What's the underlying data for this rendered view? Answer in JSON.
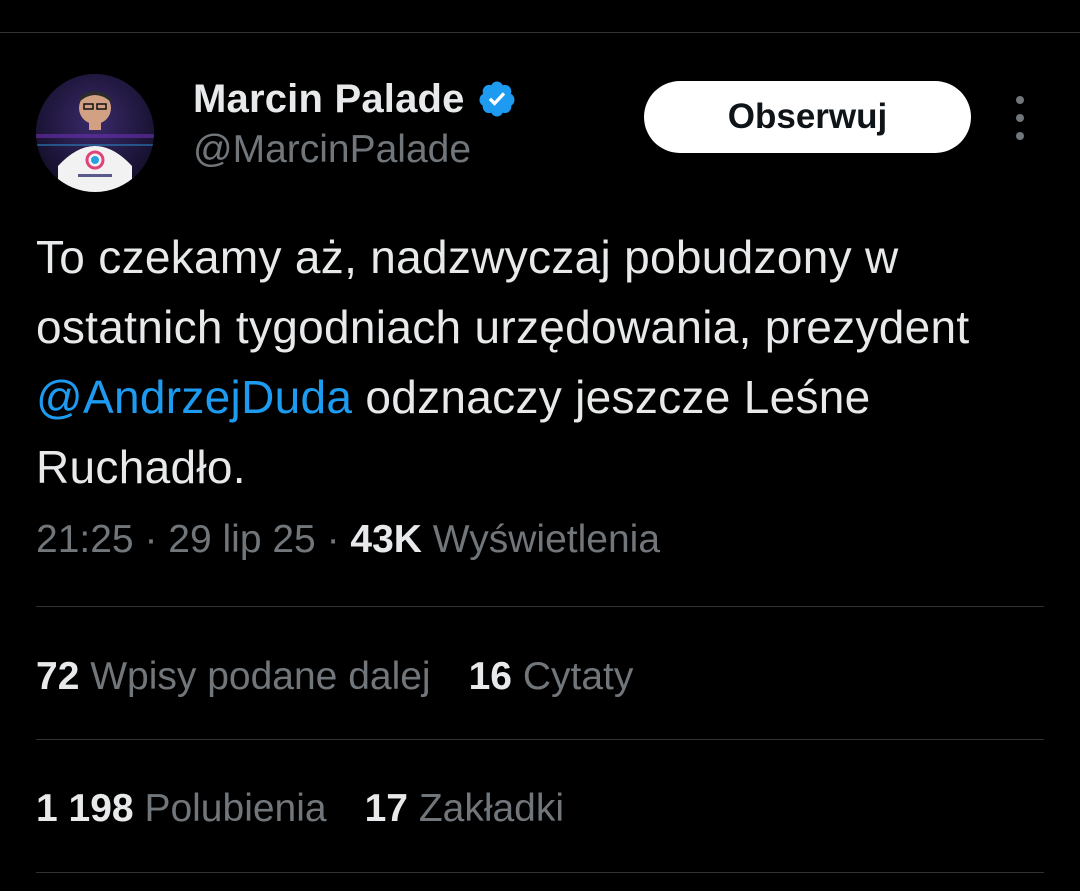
{
  "author": {
    "display_name": "Marcin Palade",
    "handle": "@MarcinPalade",
    "verified": true,
    "verified_color": "#1d9bf0"
  },
  "follow_button": {
    "label": "Obserwuj"
  },
  "tweet": {
    "text_part1": "To czekamy aż, nadzwyczaj pobudzony w ostatnich tygodniach urzędowania, prezydent ",
    "mention": "@AndrzejDuda",
    "text_part2": " odznaczy jeszcze Leśne Ruchadło."
  },
  "meta": {
    "time": "21:25",
    "separator": " · ",
    "date": "29 lip 25",
    "views_count": "43K",
    "views_label": " Wyświetlenia"
  },
  "stats": {
    "reposts": {
      "count": "72",
      "label": " Wpisy podane dalej"
    },
    "quotes": {
      "count": "16",
      "label": " Cytaty"
    },
    "likes": {
      "count": "1 198",
      "label": " Polubienia"
    },
    "bookmarks": {
      "count": "17",
      "label": " Zakładki"
    }
  },
  "colors": {
    "background": "#000000",
    "text_primary": "#e7e9ea",
    "text_secondary": "#71767b",
    "link": "#1d9bf0",
    "divider": "#2f3336"
  }
}
